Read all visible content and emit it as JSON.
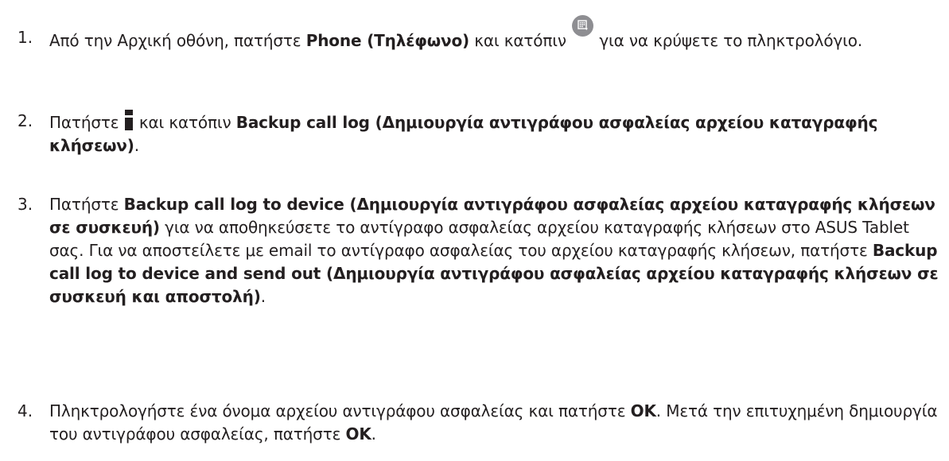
{
  "steps": [
    {
      "number": "1.",
      "parts": {
        "a": "Από την Αρχική οθόνη, πατήστε ",
        "b": "Phone (Τηλέφωνο)",
        "c": " και κατόπιν ",
        "d": " για να κρύψετε το πληκτρολόγιο."
      },
      "icon": "dialpad-toggle-icon"
    },
    {
      "number": "2.",
      "parts": {
        "a": "Πατήστε ",
        "b": " και κατόπιν ",
        "c": "Backup call log (Δημιουργία αντιγράφου ασφαλείας αρχείου καταγραφής κλήσεων)",
        "d": "."
      },
      "icon": "menu-icon"
    },
    {
      "number": "3.",
      "parts": {
        "a": "Πατήστε ",
        "b": "Backup call log to device (Δημιουργία αντιγράφου ασφαλείας αρχείου καταγραφής κλήσεων σε συσκευή)",
        "c": " για να αποθηκεύσετε το αντίγραφο ασφαλείας αρχείου καταγραφής κλήσεων στο ASUS Tablet σας. Για να αποστείλετε με email το αντίγραφο ασφαλείας του αρχείου καταγραφής κλήσεων, πατήστε ",
        "d": "Backup call log to device and send out (Δημιουργία αντιγράφου ασφαλείας αρχείου καταγραφής κλήσεων σε συσκευή και αποστολή)",
        "e": "."
      }
    },
    {
      "number": "4.",
      "parts": {
        "a": "Πληκτρολογήστε ένα όνομα αρχείου αντιγράφου ασφαλείας και πατήστε ",
        "b": "OK",
        "c": ". Μετά την επιτυχημένη δημιουργία του αντιγράφου ασφαλείας, πατήστε ",
        "d": "OK",
        "e": "."
      }
    }
  ],
  "colors": {
    "text": "#231f20",
    "icon_bg": "#8e8e92"
  }
}
